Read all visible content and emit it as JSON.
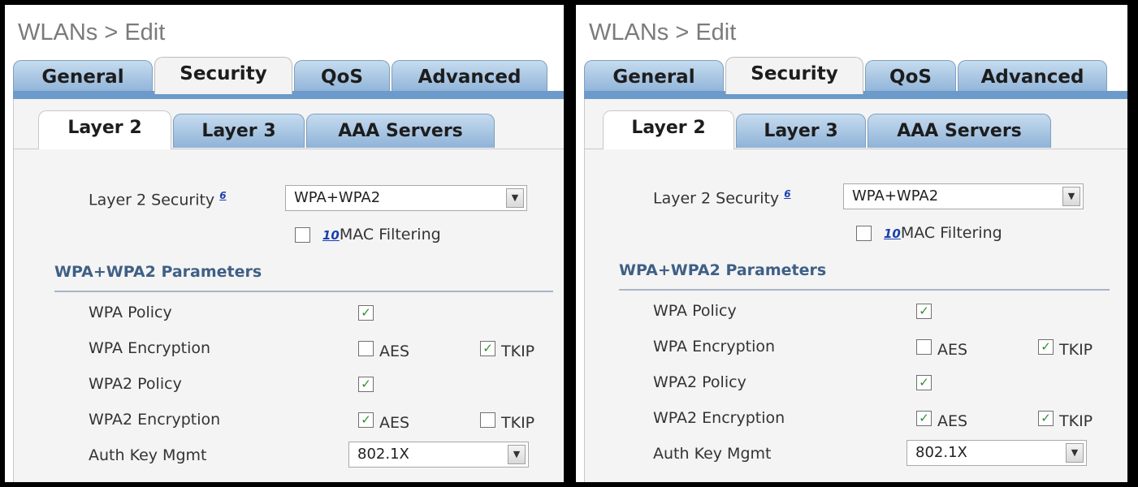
{
  "panels": [
    {
      "title": "WLANs > Edit",
      "tabs": [
        "General",
        "Security",
        "QoS",
        "Advanced"
      ],
      "active_tab": "Security",
      "subtabs": [
        "Layer 2",
        "Layer 3",
        "AAA Servers"
      ],
      "active_subtab": "Layer 2",
      "layer2_security": {
        "label": "Layer 2 Security",
        "link": "6",
        "value": "WPA+WPA2"
      },
      "mac_filtering": {
        "link": "10",
        "label": "MAC Filtering",
        "checked": false
      },
      "section_title": "WPA+WPA2 Parameters",
      "rows": {
        "wpa_policy": {
          "label": "WPA Policy",
          "checked": true
        },
        "wpa_encryption": {
          "label": "WPA Encryption",
          "aes_label": "AES",
          "aes": false,
          "tkip_label": "TKIP",
          "tkip": true
        },
        "wpa2_policy": {
          "label": "WPA2 Policy",
          "checked": true
        },
        "wpa2_encryption": {
          "label": "WPA2 Encryption",
          "aes_label": "AES",
          "aes": true,
          "tkip_label": "TKIP",
          "tkip": false
        },
        "auth_key_mgmt": {
          "label": "Auth Key Mgmt",
          "value": "802.1X"
        }
      }
    },
    {
      "title": "WLANs > Edit",
      "tabs": [
        "General",
        "Security",
        "QoS",
        "Advanced"
      ],
      "active_tab": "Security",
      "subtabs": [
        "Layer 2",
        "Layer 3",
        "AAA Servers"
      ],
      "active_subtab": "Layer 2",
      "layer2_security": {
        "label": "Layer 2 Security",
        "link": "6",
        "value": "WPA+WPA2"
      },
      "mac_filtering": {
        "link": "10",
        "label": "MAC Filtering",
        "checked": false
      },
      "section_title": "WPA+WPA2 Parameters",
      "rows": {
        "wpa_policy": {
          "label": "WPA Policy",
          "checked": true
        },
        "wpa_encryption": {
          "label": "WPA Encryption",
          "aes_label": "AES",
          "aes": false,
          "tkip_label": "TKIP",
          "tkip": true
        },
        "wpa2_policy": {
          "label": "WPA2 Policy",
          "checked": true
        },
        "wpa2_encryption": {
          "label": "WPA2 Encryption",
          "aes_label": "AES",
          "aes": true,
          "tkip_label": "TKIP",
          "tkip": true
        },
        "auth_key_mgmt": {
          "label": "Auth Key Mgmt",
          "value": "802.1X"
        }
      }
    }
  ],
  "colors": {
    "tab_gradient_top": "#c6dcef",
    "tab_gradient_bottom": "#8fb3d8",
    "band": "#6b9acb",
    "section": "#3f5f86",
    "check": "#2d8f2d"
  },
  "icons": {
    "dropdown": "chevron-down-icon",
    "check": "checkmark-icon"
  }
}
